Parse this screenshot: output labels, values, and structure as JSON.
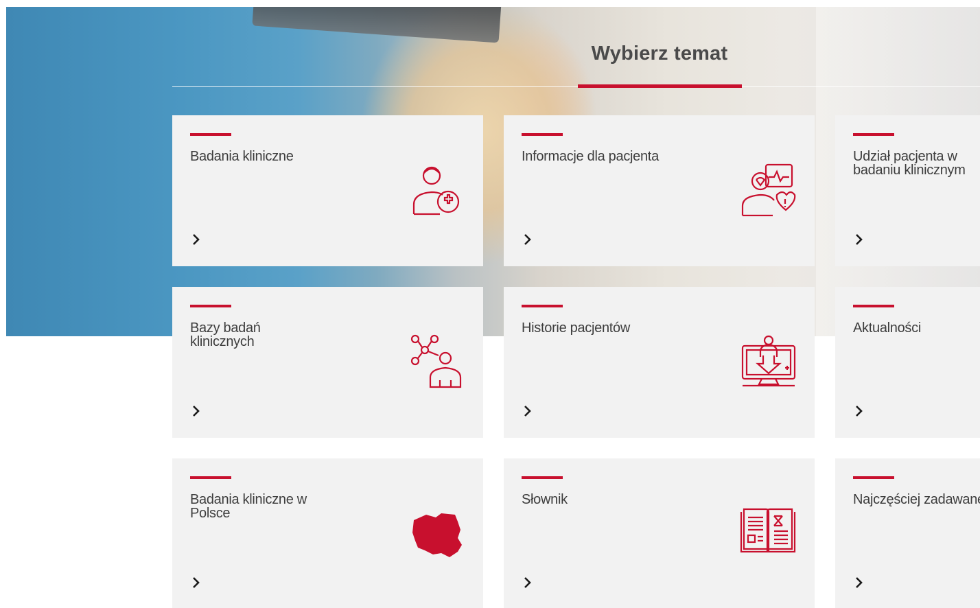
{
  "section": {
    "title": "Wybierz temat"
  },
  "colors": {
    "accent": "#c8102e",
    "tile_bg": "#f2f2f2",
    "text": "#3d3d3d"
  },
  "tiles": [
    {
      "label": "Badania kliniczne",
      "icon": "patient-plus-icon"
    },
    {
      "label": "Informacje dla pacjenta",
      "icon": "patient-heart-monitor-icon"
    },
    {
      "label": "Udział pacjenta w badaniu klinicznym",
      "icon": ""
    },
    {
      "label": "Bazy badań klinicznych",
      "icon": "network-person-icon"
    },
    {
      "label": "Historie pacjentów",
      "icon": "monitor-patient-icon"
    },
    {
      "label": "Aktualności",
      "icon": ""
    },
    {
      "label": "Badania kliniczne w Polsce",
      "icon": "poland-map-icon"
    },
    {
      "label": "Słownik",
      "icon": "open-book-icon"
    },
    {
      "label": "Najczęściej zadawane pytania",
      "icon": ""
    }
  ]
}
